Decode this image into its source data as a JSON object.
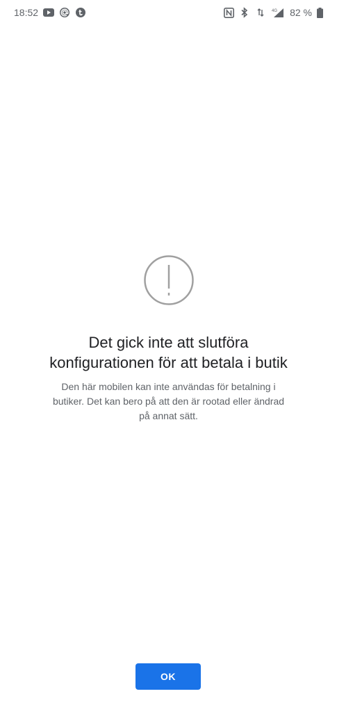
{
  "status_bar": {
    "time": "18:52",
    "battery_text": "82 %",
    "network_label": "4G",
    "left_icons": [
      "youtube-icon",
      "at-sign-icon",
      "app-badge-icon"
    ],
    "right_icons": [
      "nfc-icon",
      "bluetooth-icon",
      "data-arrows-icon",
      "signal-icon",
      "battery-icon"
    ]
  },
  "dialog": {
    "icon": "alert-circle-icon",
    "title": "Det gick inte att slutföra konfigurationen för att betala i butik",
    "message": "Den här mobilen kan inte användas för betalning i butiker. Det kan bero på att den är rootad eller ändrad på annat sätt.",
    "ok_label": "OK"
  },
  "colors": {
    "accent": "#1a73e8",
    "title_text": "#202124",
    "body_text": "#5f6368",
    "icon_stroke": "#a0a0a0"
  }
}
